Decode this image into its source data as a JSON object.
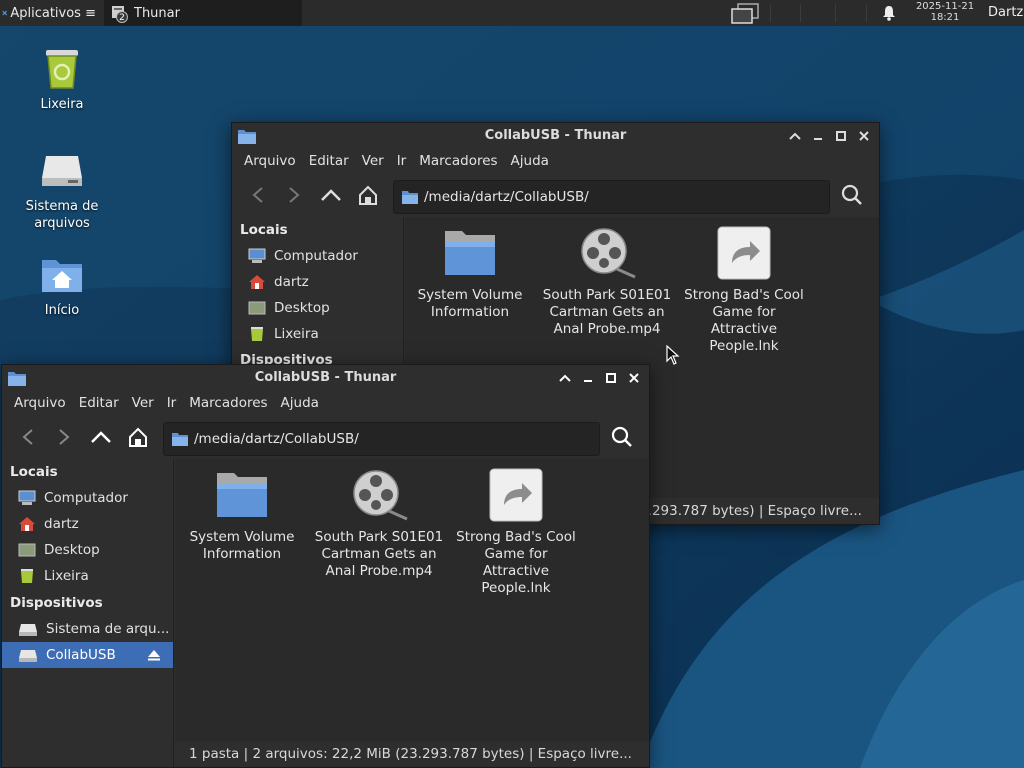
{
  "panel": {
    "apps_label": "Aplicativos",
    "task_label": "Thunar",
    "task_count": "2",
    "clock_date": "2025-11-21",
    "clock_time": "18:21",
    "user": "Dartz"
  },
  "desktop": {
    "icons": [
      {
        "label": "Lixeira",
        "icon": "trash-icon"
      },
      {
        "label": "Sistema de arquivos",
        "icon": "drive-icon"
      },
      {
        "label": "Início",
        "icon": "home-folder-icon"
      }
    ]
  },
  "back_window": {
    "title": "CollabUSB - Thunar",
    "menu": [
      "Arquivo",
      "Editar",
      "Ver",
      "Ir",
      "Marcadores",
      "Ajuda"
    ],
    "path": "/media/dartz/CollabUSB/",
    "sidebar_heading": "Locais",
    "sidebar_heading2": "Dispositivos",
    "sidebar": [
      "Computador",
      "dartz",
      "Desktop",
      "Lixeira"
    ],
    "files": [
      {
        "name": "System Volume Information",
        "icon": "folder-icon"
      },
      {
        "name": "South Park S01E01 Cartman Gets an Anal Probe.mp4",
        "icon": "video-reel-icon"
      },
      {
        "name": "Strong Bad's Cool Game for Attractive People.lnk",
        "icon": "shortcut-icon"
      }
    ],
    "status": "1 pasta  |  2 arquivos: 22,2 MiB (23.293.787 bytes)  |  Espaço livre..."
  },
  "front_window": {
    "title": "CollabUSB - Thunar",
    "menu": [
      "Arquivo",
      "Editar",
      "Ver",
      "Ir",
      "Marcadores",
      "Ajuda"
    ],
    "path": "/media/dartz/CollabUSB/",
    "sidebar_heading": "Locais",
    "sidebar": [
      "Computador",
      "dartz",
      "Desktop",
      "Lixeira"
    ],
    "devices_heading": "Dispositivos",
    "devices": [
      "Sistema de arqu...",
      "CollabUSB"
    ],
    "files": [
      {
        "name": "System Volume Information",
        "icon": "folder-icon"
      },
      {
        "name": "South Park S01E01 Cartman Gets an Anal Probe.mp4",
        "icon": "video-reel-icon"
      },
      {
        "name": "Strong Bad's Cool Game for Attractive People.lnk",
        "icon": "shortcut-icon"
      }
    ],
    "status": "1 pasta  |  2 arquivos: 22,2 MiB (23.293.787 bytes)  |  Espaço livre..."
  },
  "colors": {
    "selection": "#3d6eb5",
    "window_bg": "#2e2e2e",
    "panel_bg": "#2b2b2b"
  }
}
